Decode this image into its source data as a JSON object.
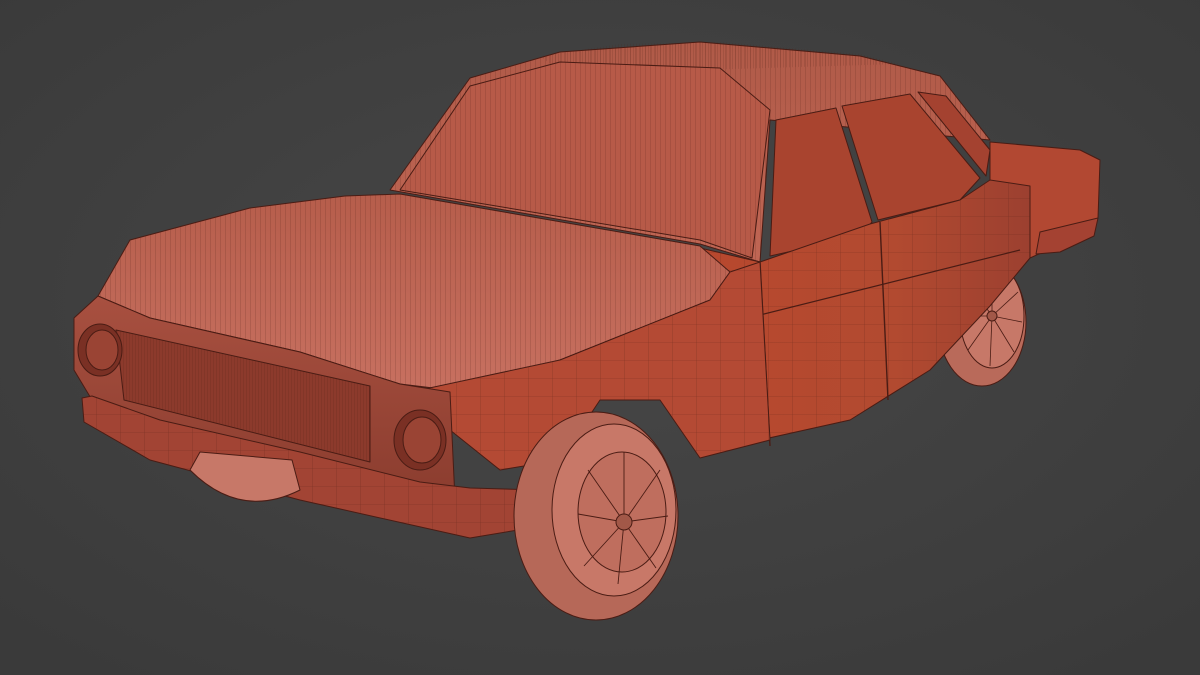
{
  "viewport": {
    "background": "#3f3f3f",
    "background_center": "#474747"
  },
  "model": {
    "subject": "car-wireframe",
    "display_mode": "solid-with-wireframe",
    "colors": {
      "body_light": "#c46a56",
      "body_mid": "#b5513c",
      "body_dark": "#8e3a2a",
      "body_shadow": "#6a2a1f",
      "glass": "#a9442f",
      "wire": "#4a1c14",
      "wheel": "#c87868",
      "wheel_dark": "#a25848"
    }
  }
}
